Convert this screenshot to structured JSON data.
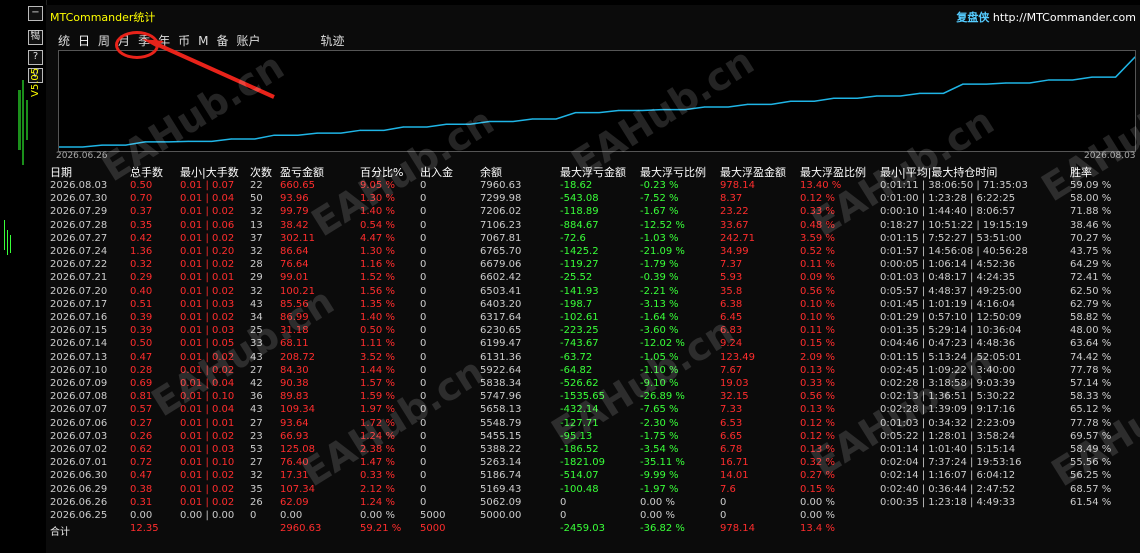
{
  "window": {
    "title": "MTCommander统计",
    "brand_cn": "复盘侠",
    "brand_url": "http://MTCommander.com",
    "version": "V5.05"
  },
  "left_strip": {
    "buttons": [
      "−",
      "㹇",
      "?",
      "√"
    ]
  },
  "tabs": [
    "统",
    "日",
    "周",
    "月",
    "季",
    "年",
    "币",
    "M",
    "备",
    "账户",
    "轨迹"
  ],
  "active_tab": "日",
  "chart": {
    "start_date": "2026.06.26",
    "end_date": "2026.08.03",
    "line_color": "#1fb5e6"
  },
  "chart_data": {
    "type": "line",
    "x": [
      "2026.06.25",
      "2026.06.26",
      "2026.06.29",
      "2026.06.30",
      "2026.07.01",
      "2026.07.02",
      "2026.07.03",
      "2026.07.06",
      "2026.07.07",
      "2026.07.08",
      "2026.07.09",
      "2026.07.10",
      "2026.07.13",
      "2026.07.14",
      "2026.07.15",
      "2026.07.16",
      "2026.07.17",
      "2026.07.20",
      "2026.07.21",
      "2026.07.22",
      "2026.07.24",
      "2026.07.27",
      "2026.07.28",
      "2026.07.29",
      "2026.07.30",
      "2026.08.03"
    ],
    "series": [
      {
        "values": [
          5000.0,
          5062.09,
          5169.43,
          5186.74,
          5263.14,
          5388.22,
          5455.15,
          5548.79,
          5658.13,
          5747.96,
          5838.34,
          5922.64,
          6131.36,
          6199.47,
          6230.65,
          6317.64,
          6403.2,
          6503.41,
          6602.42,
          6679.06,
          6765.7,
          7067.81,
          7106.23,
          7206.02,
          7299.98,
          7960.63
        ]
      }
    ],
    "title": "",
    "xlabel": "",
    "ylabel": ""
  },
  "table": {
    "headers": [
      "日期",
      "总手数",
      "最小|大手数",
      "次数",
      "盈亏金额",
      "百分比%",
      "出入金",
      "余额",
      "最大浮亏金额",
      "最大浮亏比例",
      "最大浮盈金额",
      "最大浮盈比例",
      "最小|平均|最大持仓时间",
      "胜率"
    ],
    "rows": [
      [
        "2026.08.03",
        "0.50",
        "0.01 | 0.07",
        "22",
        "660.65",
        "9.05 %",
        "0",
        "7960.63",
        "-18.62",
        "-0.23 %",
        "978.14",
        "13.40 %",
        "0:01:11 | 38:06:50 | 71:35:03",
        "59.09 %"
      ],
      [
        "2026.07.30",
        "0.70",
        "0.01 | 0.04",
        "50",
        "93.96",
        "1.30 %",
        "0",
        "7299.98",
        "-543.08",
        "-7.52 %",
        "8.37",
        "0.12 %",
        "0:01:00 | 1:23:28 | 6:22:25",
        "58.00 %"
      ],
      [
        "2026.07.29",
        "0.37",
        "0.01 | 0.02",
        "32",
        "99.79",
        "1.40 %",
        "0",
        "7206.02",
        "-118.89",
        "-1.67 %",
        "23.22",
        "0.33 %",
        "0:00:10 | 1:44:40 | 8:06:57",
        "71.88 %"
      ],
      [
        "2026.07.28",
        "0.35",
        "0.01 | 0.06",
        "13",
        "38.42",
        "0.54 %",
        "0",
        "7106.23",
        "-884.67",
        "-12.52 %",
        "33.67",
        "0.48 %",
        "0:18:27 | 10:51:22 | 19:15:19",
        "38.46 %"
      ],
      [
        "2026.07.27",
        "0.42",
        "0.01 | 0.02",
        "37",
        "302.11",
        "4.47 %",
        "0",
        "7067.81",
        "-72.6",
        "-1.03 %",
        "242.71",
        "3.59 %",
        "0:01:15 | 7:52:27 | 53:51:00",
        "70.27 %"
      ],
      [
        "2026.07.24",
        "1.36",
        "0.01 | 0.20",
        "32",
        "86.64",
        "1.30 %",
        "0",
        "6765.70",
        "-1425.2",
        "-21.09 %",
        "34.99",
        "0.52 %",
        "0:01:57 | 14:56:08 | 40:56:28",
        "43.75 %"
      ],
      [
        "2026.07.22",
        "0.32",
        "0.01 | 0.02",
        "28",
        "76.64",
        "1.16 %",
        "0",
        "6679.06",
        "-119.27",
        "-1.79 %",
        "7.37",
        "0.11 %",
        "0:00:05 | 1:06:14 | 4:52:36",
        "64.29 %"
      ],
      [
        "2026.07.21",
        "0.29",
        "0.01 | 0.01",
        "29",
        "99.01",
        "1.52 %",
        "0",
        "6602.42",
        "-25.52",
        "-0.39 %",
        "5.93",
        "0.09 %",
        "0:01:03 | 0:48:17 | 4:24:35",
        "72.41 %"
      ],
      [
        "2026.07.20",
        "0.40",
        "0.01 | 0.02",
        "32",
        "100.21",
        "1.56 %",
        "0",
        "6503.41",
        "-141.93",
        "-2.21 %",
        "35.8",
        "0.56 %",
        "0:05:57 | 4:48:37 | 49:25:00",
        "62.50 %"
      ],
      [
        "2026.07.17",
        "0.51",
        "0.01 | 0.03",
        "43",
        "85.56",
        "1.35 %",
        "0",
        "6403.20",
        "-198.7",
        "-3.13 %",
        "6.38",
        "0.10 %",
        "0:01:45 | 1:01:19 | 4:16:04",
        "62.79 %"
      ],
      [
        "2026.07.16",
        "0.39",
        "0.01 | 0.02",
        "34",
        "86.99",
        "1.40 %",
        "0",
        "6317.64",
        "-102.61",
        "-1.64 %",
        "6.45",
        "0.10 %",
        "0:01:29 | 0:57:10 | 12:50:09",
        "58.82 %"
      ],
      [
        "2026.07.15",
        "0.39",
        "0.01 | 0.03",
        "25",
        "31.18",
        "0.50 %",
        "0",
        "6230.65",
        "-223.25",
        "-3.60 %",
        "6.83",
        "0.11 %",
        "0:01:35 | 5:29:14 | 10:36:04",
        "48.00 %"
      ],
      [
        "2026.07.14",
        "0.50",
        "0.01 | 0.05",
        "33",
        "68.11",
        "1.11 %",
        "0",
        "6199.47",
        "-743.67",
        "-12.02 %",
        "9.24",
        "0.15 %",
        "0:04:46 | 0:47:23 | 4:48:36",
        "63.64 %"
      ],
      [
        "2026.07.13",
        "0.47",
        "0.01 | 0.02",
        "43",
        "208.72",
        "3.52 %",
        "0",
        "6131.36",
        "-63.72",
        "-1.05 %",
        "123.49",
        "2.09 %",
        "0:01:15 | 5:13:24 | 52:05:01",
        "74.42 %"
      ],
      [
        "2026.07.10",
        "0.28",
        "0.01 | 0.02",
        "27",
        "84.30",
        "1.44 %",
        "0",
        "5922.64",
        "-64.82",
        "-1.10 %",
        "7.67",
        "0.13 %",
        "0:02:45 | 1:09:22 | 3:40:00",
        "77.78 %"
      ],
      [
        "2026.07.09",
        "0.69",
        "0.01 | 0.04",
        "42",
        "90.38",
        "1.57 %",
        "0",
        "5838.34",
        "-526.62",
        "-9.10 %",
        "19.03",
        "0.33 %",
        "0:02:28 | 3:18:58 | 9:03:39",
        "57.14 %"
      ],
      [
        "2026.07.08",
        "0.81",
        "0.01 | 0.10",
        "36",
        "89.83",
        "1.59 %",
        "0",
        "5747.96",
        "-1535.65",
        "-26.89 %",
        "32.15",
        "0.56 %",
        "0:02:13 | 1:36:51 | 5:30:22",
        "58.33 %"
      ],
      [
        "2026.07.07",
        "0.57",
        "0.01 | 0.04",
        "43",
        "109.34",
        "1.97 %",
        "0",
        "5658.13",
        "-432.14",
        "-7.65 %",
        "7.33",
        "0.13 %",
        "0:02:28 | 1:39:09 | 9:17:16",
        "65.12 %"
      ],
      [
        "2026.07.06",
        "0.27",
        "0.01 | 0.01",
        "27",
        "93.64",
        "1.72 %",
        "0",
        "5548.79",
        "-127.71",
        "-2.30 %",
        "6.53",
        "0.12 %",
        "0:01:03 | 0:34:32 | 2:23:09",
        "77.78 %"
      ],
      [
        "2026.07.03",
        "0.26",
        "0.01 | 0.02",
        "23",
        "66.93",
        "1.24 %",
        "0",
        "5455.15",
        "-95.13",
        "-1.75 %",
        "6.65",
        "0.12 %",
        "0:05:22 | 1:28:01 | 3:58:24",
        "69.57 %"
      ],
      [
        "2026.07.02",
        "0.62",
        "0.01 | 0.03",
        "53",
        "125.08",
        "2.38 %",
        "0",
        "5388.22",
        "-186.52",
        "-3.54 %",
        "6.78",
        "0.13 %",
        "0:01:14 | 1:01:40 | 5:15:14",
        "58.49 %"
      ],
      [
        "2026.07.01",
        "0.72",
        "0.01 | 0.10",
        "27",
        "76.40",
        "1.47 %",
        "0",
        "5263.14",
        "-1821.09",
        "-35.11 %",
        "16.71",
        "0.32 %",
        "0:02:04 | 7:37:24 | 19:53:16",
        "55.56 %"
      ],
      [
        "2026.06.30",
        "0.47",
        "0.01 | 0.02",
        "32",
        "17.31",
        "0.33 %",
        "0",
        "5186.74",
        "-514.07",
        "-9.99 %",
        "14.01",
        "0.27 %",
        "0:02:14 | 1:16:07 | 6:04:12",
        "56.25 %"
      ],
      [
        "2026.06.29",
        "0.38",
        "0.01 | 0.02",
        "35",
        "107.34",
        "2.12 %",
        "0",
        "5169.43",
        "-100.48",
        "-1.97 %",
        "7.6",
        "0.15 %",
        "0:02:40 | 0:36:44 | 2:47:52",
        "68.57 %"
      ],
      [
        "2026.06.26",
        "0.31",
        "0.01 | 0.02",
        "26",
        "62.09",
        "1.24 %",
        "0",
        "5062.09",
        "0",
        "0.00 %",
        "0",
        "0.00 %",
        "0:00:35 | 1:23:18 | 4:49:33",
        "61.54 %"
      ],
      [
        "2026.06.25",
        "0.00",
        "0.00 | 0.00",
        "0",
        "0.00",
        "0.00 %",
        "5000",
        "5000.00",
        "0",
        "0.00 %",
        "0",
        "0.00 %",
        "",
        ""
      ]
    ],
    "total": [
      "合计",
      "12.35",
      "",
      "",
      "2960.63",
      "59.21 %",
      "5000",
      "",
      "-2459.03",
      "-36.82 %",
      "978.14",
      "13.4 %",
      "",
      ""
    ]
  },
  "watermark": "EAHub.cn",
  "colors": {
    "positive": "#ff2d2d",
    "negative": "#39ff39",
    "title": "#ffff00",
    "annotation": "#e8231a"
  }
}
